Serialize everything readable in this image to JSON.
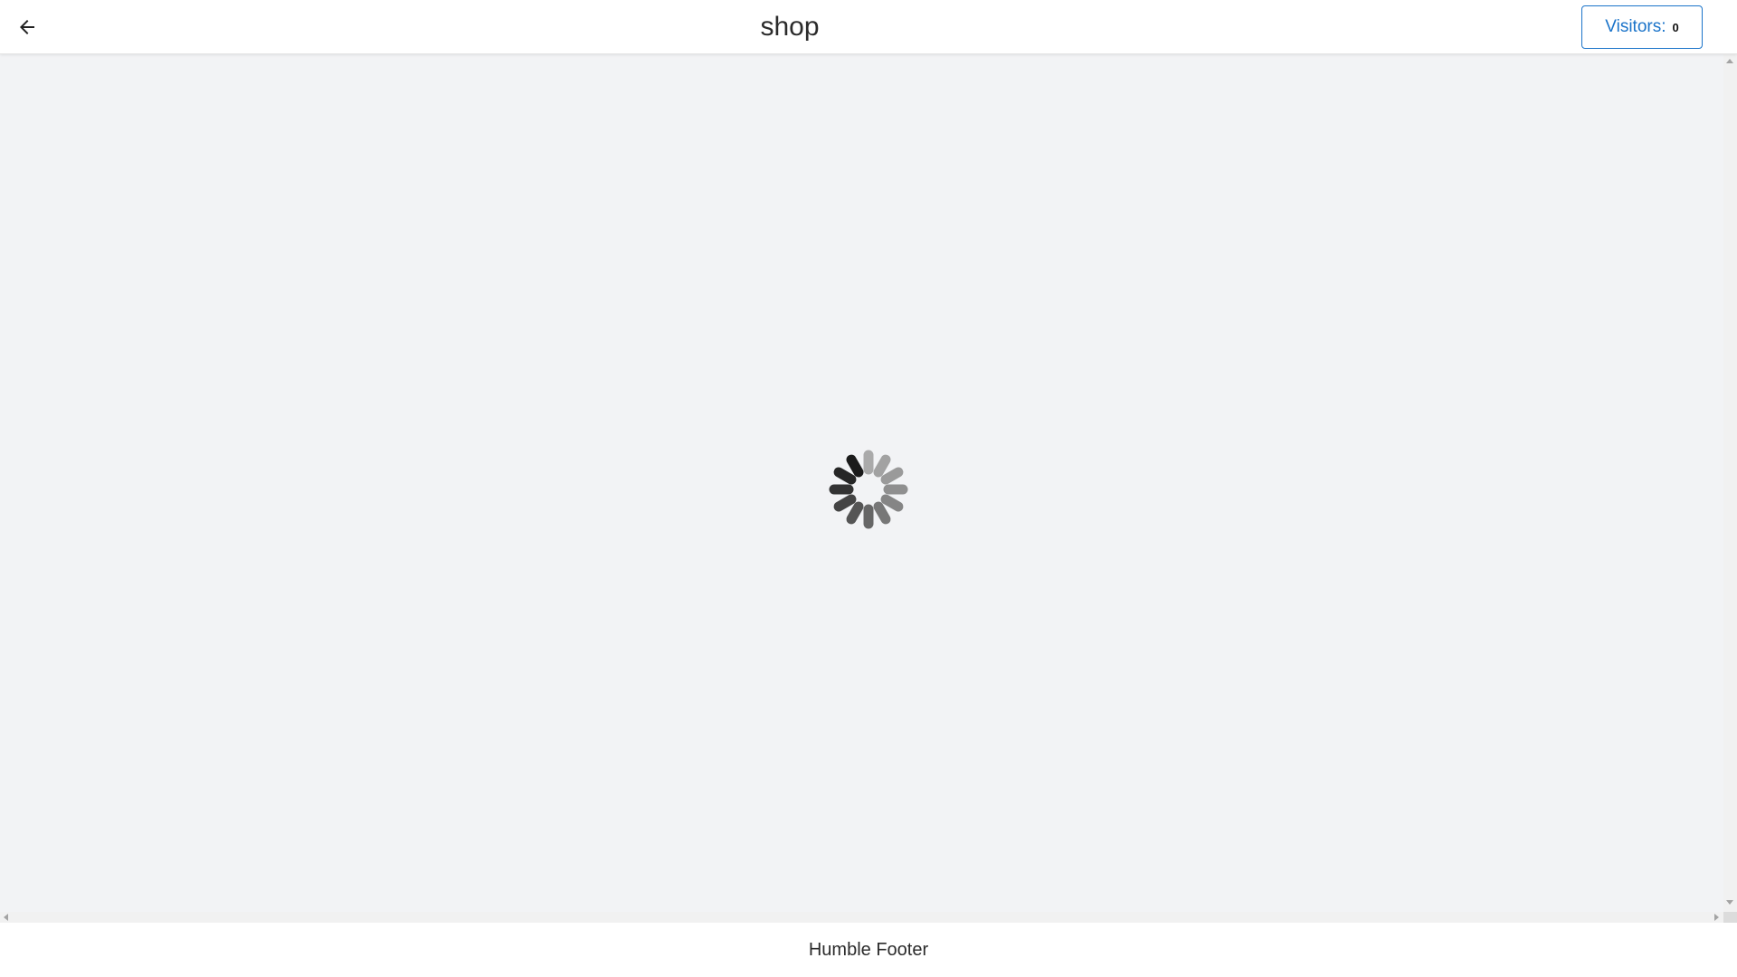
{
  "header": {
    "back_icon": "arrow-left-icon",
    "title": "shop",
    "visitors": {
      "label": "Visitors:",
      "count": "0",
      "accent_color": "#1a73c9"
    }
  },
  "main": {
    "background_color": "#f2f3f5",
    "loading_icon": "spinner-icon"
  },
  "footer": {
    "text": "Humble Footer"
  }
}
